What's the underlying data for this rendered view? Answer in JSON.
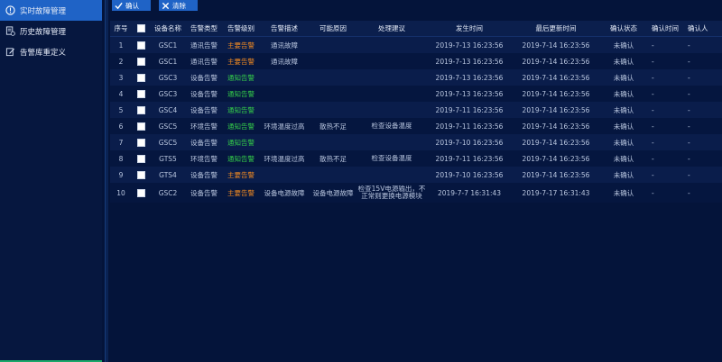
{
  "sidebar": {
    "items": [
      {
        "label": "实时故障管理",
        "active": true
      },
      {
        "label": "历史故障管理",
        "active": false
      },
      {
        "label": "告警库重定义",
        "active": false
      }
    ]
  },
  "toolbar": {
    "confirm_label": "确认",
    "clear_label": "清除"
  },
  "table": {
    "headers": {
      "index": "序号",
      "device": "设备名称",
      "type": "告警类型",
      "level": "告警级别",
      "desc": "告警描述",
      "cause": "可能原因",
      "suggest": "处理建议",
      "occur": "发生时间",
      "update": "最后更新时间",
      "status": "确认状态",
      "confirm_time": "确认时间",
      "confirm_user": "确认人"
    },
    "rows": [
      {
        "index": "1",
        "device": "GSC1",
        "type": "通讯告警",
        "level": "主要告警",
        "level_kind": "major",
        "desc": "通讯故障",
        "cause": "",
        "suggest": "",
        "occur": "2019-7-13 16:23:56",
        "update": "2019-7-14 16:23:56",
        "status": "未确认",
        "confirm_time": "-",
        "confirm_user": "-"
      },
      {
        "index": "2",
        "device": "GSC1",
        "type": "通讯告警",
        "level": "主要告警",
        "level_kind": "major",
        "desc": "通讯故障",
        "cause": "",
        "suggest": "",
        "occur": "2019-7-13 16:23:56",
        "update": "2019-7-14 16:23:56",
        "status": "未确认",
        "confirm_time": "-",
        "confirm_user": "-"
      },
      {
        "index": "3",
        "device": "GSC3",
        "type": "设备告警",
        "level": "通知告警",
        "level_kind": "notice",
        "desc": "",
        "cause": "",
        "suggest": "",
        "occur": "2019-7-13 16:23:56",
        "update": "2019-7-14 16:23:56",
        "status": "未确认",
        "confirm_time": "-",
        "confirm_user": "-"
      },
      {
        "index": "4",
        "device": "GSC3",
        "type": "设备告警",
        "level": "通知告警",
        "level_kind": "notice",
        "desc": "",
        "cause": "",
        "suggest": "",
        "occur": "2019-7-13 16:23:56",
        "update": "2019-7-14 16:23:56",
        "status": "未确认",
        "confirm_time": "-",
        "confirm_user": "-"
      },
      {
        "index": "5",
        "device": "GSC4",
        "type": "设备告警",
        "level": "通知告警",
        "level_kind": "notice",
        "desc": "",
        "cause": "",
        "suggest": "",
        "occur": "2019-7-11 16:23:56",
        "update": "2019-7-14 16:23:56",
        "status": "未确认",
        "confirm_time": "-",
        "confirm_user": "-"
      },
      {
        "index": "6",
        "device": "GSC5",
        "type": "环境告警",
        "level": "通知告警",
        "level_kind": "notice",
        "desc": "环境温度过高",
        "cause": "散热不足",
        "suggest": "检查设备温度",
        "occur": "2019-7-11 16:23:56",
        "update": "2019-7-14 16:23:56",
        "status": "未确认",
        "confirm_time": "-",
        "confirm_user": "-"
      },
      {
        "index": "7",
        "device": "GSC5",
        "type": "设备告警",
        "level": "通知告警",
        "level_kind": "notice",
        "desc": "",
        "cause": "",
        "suggest": "",
        "occur": "2019-7-10 16:23:56",
        "update": "2019-7-14 16:23:56",
        "status": "未确认",
        "confirm_time": "-",
        "confirm_user": "-"
      },
      {
        "index": "8",
        "device": "GTS5",
        "type": "环境告警",
        "level": "通知告警",
        "level_kind": "notice",
        "desc": "环境温度过高",
        "cause": "散热不足",
        "suggest": "检查设备温度",
        "occur": "2019-7-11 16:23:56",
        "update": "2019-7-14 16:23:56",
        "status": "未确认",
        "confirm_time": "-",
        "confirm_user": "-"
      },
      {
        "index": "9",
        "device": "GTS4",
        "type": "设备告警",
        "level": "主要告警",
        "level_kind": "major",
        "desc": "",
        "cause": "",
        "suggest": "",
        "occur": "2019-7-10 16:23:56",
        "update": "2019-7-14 16:23:56",
        "status": "未确认",
        "confirm_time": "-",
        "confirm_user": "-"
      },
      {
        "index": "10",
        "device": "GSC2",
        "type": "设备告警",
        "level": "主要告警",
        "level_kind": "major",
        "desc": "设备电源故障",
        "cause": "设备电源故障",
        "suggest": "检查15V电源输出，不正常则更换电源模块",
        "occur": "2019-7-7 16:31:43",
        "update": "2019-7-17 16:31:43",
        "status": "未确认",
        "confirm_time": "-",
        "confirm_user": "-"
      }
    ]
  },
  "colors": {
    "accent": "#1f63c6",
    "major": "#f28b22",
    "notice": "#35d04a",
    "background": "#04143a"
  }
}
